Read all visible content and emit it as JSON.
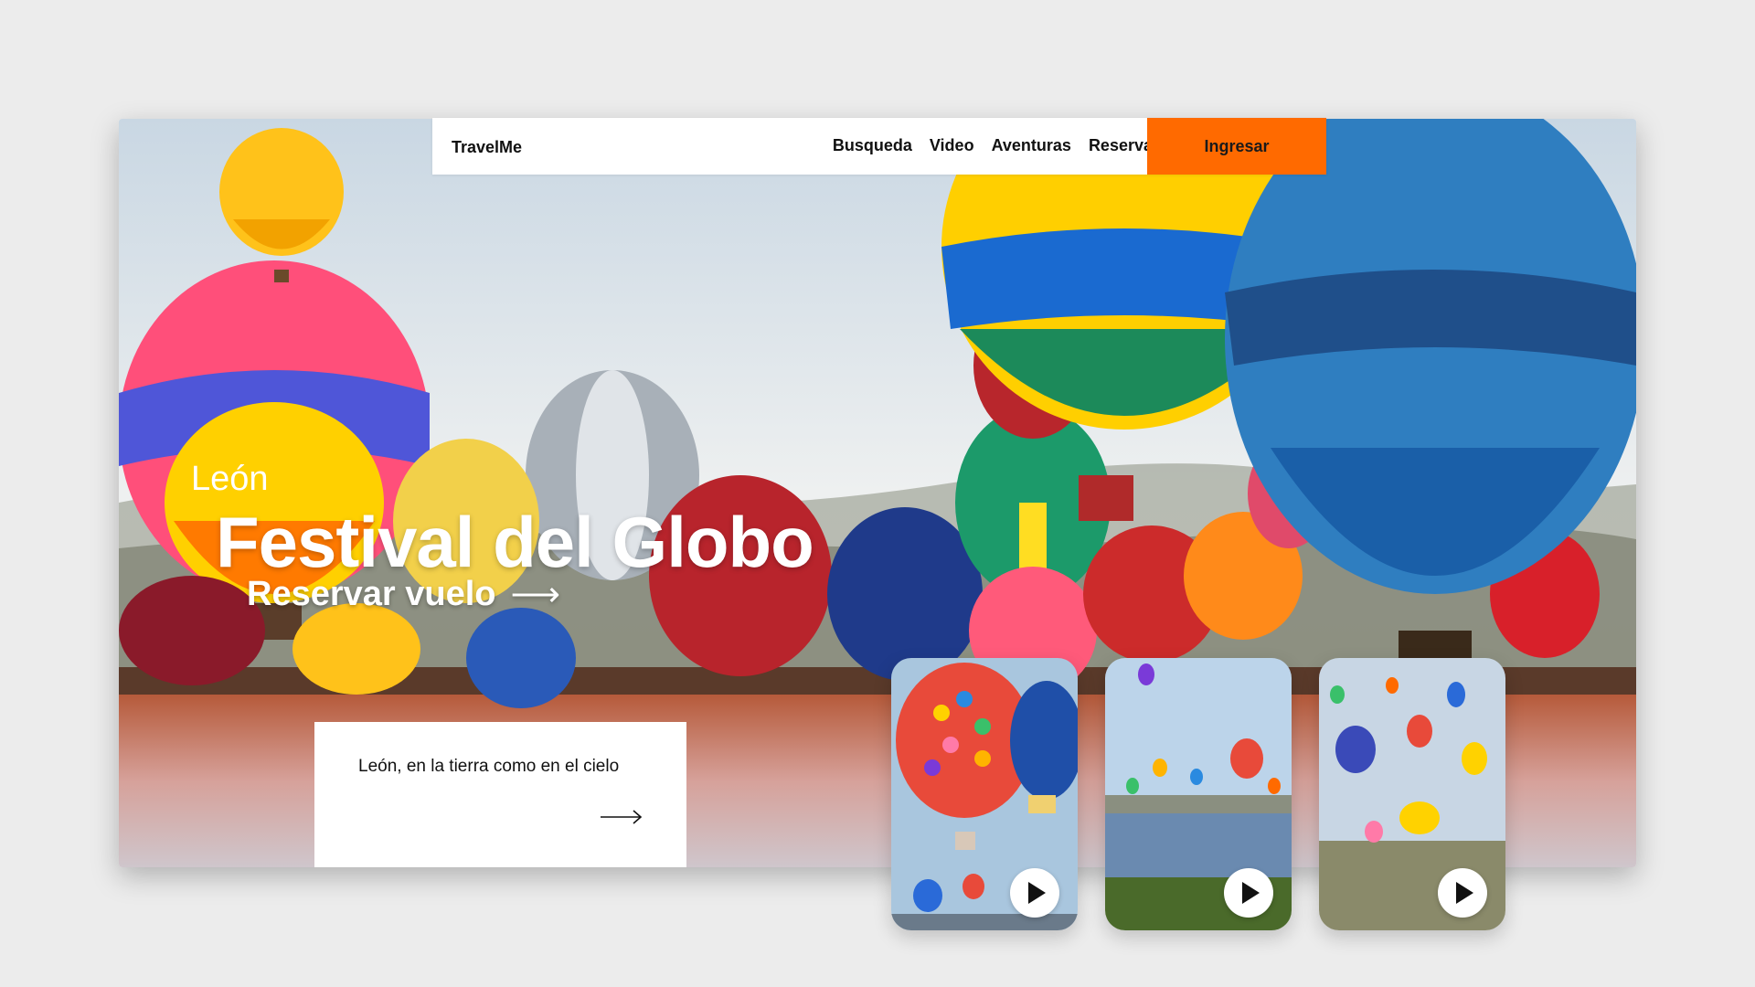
{
  "nav": {
    "brand": "TravelMe",
    "links": [
      "Busqueda",
      "Video",
      "Aventuras",
      "Reserva"
    ],
    "cta": "Ingresar"
  },
  "hero": {
    "city": "León",
    "title": "Festival del Globo",
    "book_label": "Reservar vuelo",
    "book_arrow": "⟶"
  },
  "info": {
    "text": "León, en la tierra como en el cielo"
  },
  "videos": [
    {
      "label": "video-1"
    },
    {
      "label": "video-2"
    },
    {
      "label": "video-3"
    }
  ],
  "colors": {
    "accent": "#ff6a00",
    "card": "#ffffff",
    "background": "#ececec"
  }
}
